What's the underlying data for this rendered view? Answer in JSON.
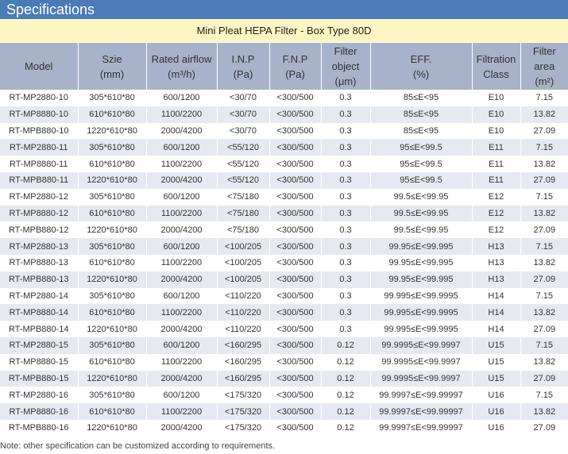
{
  "banner": {
    "title": "Specifications"
  },
  "table": {
    "title": "Mini Pleat HEPA Filter - Box Type 80D",
    "headers": [
      "Model",
      "Szie\n(mm)",
      "Rated airflow\n(m³/h)",
      "I.N.P\n(Pa)",
      "F.N.P\n(Pa)",
      "Filter\nobject\n(μm)",
      "EFF.\n(%)",
      "Filtration\nClass",
      "Filter\narea\n(m²)"
    ],
    "rows": [
      [
        "RT-MP2880-10",
        "305*610*80",
        "600/1200",
        "<30/70",
        "<300/500",
        "0.3",
        "85≤E<95",
        "E10",
        "7.15"
      ],
      [
        "RT-MP8880-10",
        "610*610*80",
        "1100/2200",
        "<30/70",
        "<300/500",
        "0.3",
        "85≤E<95",
        "E10",
        "13.82"
      ],
      [
        "RT-MPB880-10",
        "1220*610*80",
        "2000/4200",
        "<30/70",
        "<300/500",
        "0.3",
        "85≤E<95",
        "E10",
        "27.09"
      ],
      [
        "RT-MP2880-11",
        "305*610*80",
        "600/1200",
        "<55/120",
        "<300/500",
        "0.3",
        "95≤E<99.5",
        "E11",
        "7.15"
      ],
      [
        "RT-MP8880-11",
        "610*610*80",
        "1100/2200",
        "<55/120",
        "<300/500",
        "0.3",
        "95≤E<99.5",
        "E11",
        "13.82"
      ],
      [
        "RT-MPB880-11",
        "1220*610*80",
        "2000/4200",
        "<55/120",
        "<300/500",
        "0.3",
        "95≤E<99.5",
        "E11",
        "27.09"
      ],
      [
        "RT-MP2880-12",
        "305*610*80",
        "600/1200",
        "<75/180",
        "<300/500",
        "0.3",
        "99.5≤E<99.95",
        "E12",
        "7.15"
      ],
      [
        "RT-MP8880-12",
        "610*610*80",
        "1100/2200",
        "<75/180",
        "<300/500",
        "0.3",
        "99.5≤E<99.95",
        "E12",
        "13.82"
      ],
      [
        "RT-MPB880-12",
        "1220*610*80",
        "2000/4200",
        "<75/180",
        "<300/500",
        "0.3",
        "99.5≤E<99.95",
        "E12",
        "27.09"
      ],
      [
        "RT-MP2880-13",
        "305*610*80",
        "600/1200",
        "<100/205",
        "<300/500",
        "0.3",
        "99.95≤E<99.995",
        "H13",
        "7.15"
      ],
      [
        "RT-MP8880-13",
        "610*610*80",
        "1100/2200",
        "<100/205",
        "<300/500",
        "0.3",
        "99.95≤E<99.995",
        "H13",
        "13.82"
      ],
      [
        "RT-MPB880-13",
        "1220*610*80",
        "2000/4200",
        "<100/205",
        "<300/500",
        "0.3",
        "99.95≤E<99.995",
        "H13",
        "27.09"
      ],
      [
        "RT-MP2880-14",
        "305*610*80",
        "600/1200",
        "<110/220",
        "<300/500",
        "0.3",
        "99.995≤E<99.9995",
        "H14",
        "7.15"
      ],
      [
        "RT-MP8880-14",
        "610*610*80",
        "1100/2200",
        "<110/220",
        "<300/500",
        "0.3",
        "99.995≤E<99.9995",
        "H14",
        "13.82"
      ],
      [
        "RT-MPB880-14",
        "1220*610*80",
        "2000/4200",
        "<110/220",
        "<300/500",
        "0.3",
        "99.995≤E<99.9995",
        "H14",
        "27.09"
      ],
      [
        "RT-MP2880-15",
        "305*610*80",
        "600/1200",
        "<160/295",
        "<300/500",
        "0.12",
        "99.9995≤E<99.9997",
        "U15",
        "7.15"
      ],
      [
        "RT-MP8880-15",
        "610*610*80",
        "1100/2200",
        "<160/295",
        "<300/500",
        "0.12",
        "99.9995≤E<99.9997",
        "U15",
        "13.82"
      ],
      [
        "RT-MPB880-15",
        "1220*610*80",
        "2000/4200",
        "<160/295",
        "<300/500",
        "0.12",
        "99.9995≤E<99.9997",
        "U15",
        "27.09"
      ],
      [
        "RT-MP2880-16",
        "305*610*80",
        "600/1200",
        "<175/320",
        "<300/500",
        "0.12",
        "99.9997≤E<99.99997",
        "U16",
        "7.15"
      ],
      [
        "RT-MP8880-16",
        "610*610*80",
        "1100/2200",
        "<175/320",
        "<300/500",
        "0.12",
        "99.9997≤E<99.99997",
        "U16",
        "13.82"
      ],
      [
        "RT-MPB880-16",
        "1220*610*80",
        "2000/4200",
        "<175/320",
        "<300/500",
        "0.12",
        "99.9997≤E<99.99997",
        "U16",
        "27.09"
      ]
    ]
  },
  "note": "Note: other specification can be customized according to requirements.",
  "colors": {
    "banner": "#4a7ab8",
    "title_row": "#fdf6c3",
    "header_row": "#a8b2c8",
    "alt_row": "#e6e9f0"
  }
}
